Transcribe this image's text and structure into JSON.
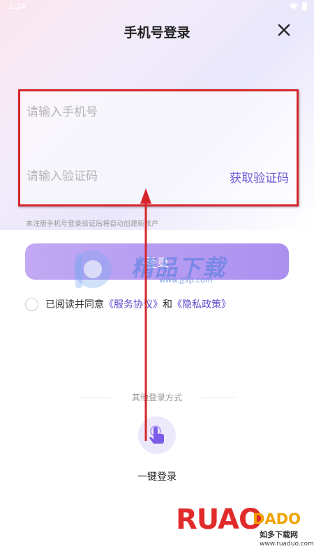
{
  "status_bar": {
    "time": "2:24"
  },
  "header": {
    "title": "手机号登录"
  },
  "form": {
    "phone_placeholder": "请输入手机号",
    "code_placeholder": "请输入验证码",
    "get_code_label": "获取验证码"
  },
  "hint": "未注册手机号登录验证后将自动创建新账户",
  "login_button": "登录",
  "agreement": {
    "prefix": "已阅读并同意",
    "service_link": "《服务协议》",
    "conjunction": "和",
    "privacy_link": "《隐私政策》"
  },
  "watermark": {
    "text": "精品下载",
    "url": "www.jj9p.com"
  },
  "other_login": {
    "label": "其他登录方式",
    "one_click_label": "一键登录"
  },
  "brand_watermark": {
    "big": "RUAO",
    "sub": "DADO",
    "cn": "如多下载网",
    "url": "www.ruaduo.com"
  },
  "colors": {
    "accent": "#6e5bd6",
    "button": "#b59ff2",
    "annotation": "#d6262b"
  },
  "icons": {
    "close": "close-icon",
    "one_click": "tap-hand-icon",
    "wifi": "wifi-icon",
    "battery": "battery-icon"
  }
}
